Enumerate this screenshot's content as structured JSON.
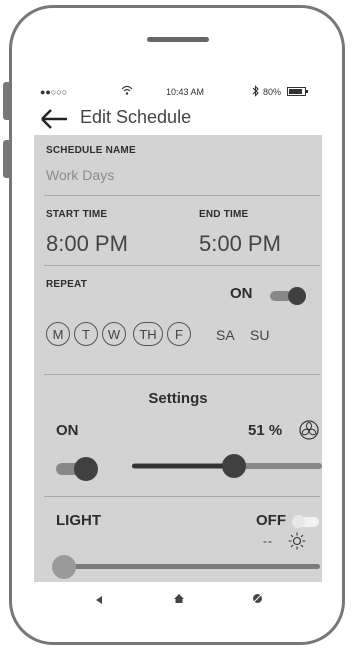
{
  "status": {
    "signal": "●●○○○",
    "time": "10:43 AM",
    "battery": "80%"
  },
  "header": {
    "title": "Edit Schedule"
  },
  "schedule_name": {
    "label": "SCHEDULE NAME",
    "value": "Work Days"
  },
  "times": {
    "start_label": "START TIME",
    "start_value": "8:00 PM",
    "end_label": "END TIME",
    "end_value": "5:00 PM"
  },
  "repeat": {
    "label": "REPEAT",
    "state": "ON"
  },
  "days": [
    "M",
    "T",
    "W",
    "TH",
    "F"
  ],
  "days_plain": [
    "SA",
    "SU"
  ],
  "settings": {
    "title": "Settings",
    "power_label": "ON",
    "fan_value": "51 %"
  },
  "light": {
    "label": "LIGHT",
    "state": "OFF",
    "value": "-- "
  }
}
